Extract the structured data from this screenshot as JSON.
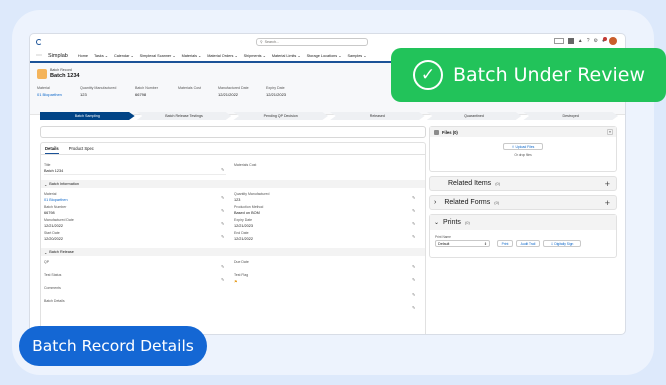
{
  "header": {
    "search_placeholder": "Search...",
    "app_name": "Simplab",
    "nav_items": [
      "Home",
      "Tasks",
      "Calendar",
      "Simplexal Scanner",
      "Materials",
      "Material Orders",
      "Shipments",
      "Material Limits",
      "Storage Locations",
      "Samples"
    ]
  },
  "record": {
    "type_label": "Batch Record",
    "name": "Batch 1234",
    "fields": [
      {
        "label": "Material",
        "value": "01 Bioparthen",
        "link": true
      },
      {
        "label": "Quantity Manufactured",
        "value": "123",
        "link": false
      },
      {
        "label": "Batch Number",
        "value": "66798",
        "link": false
      },
      {
        "label": "Materials Cost",
        "value": "",
        "link": false
      },
      {
        "label": "Manufactured Date",
        "value": "12/21/2022",
        "link": false
      },
      {
        "label": "Expiry Date",
        "value": "12/21/2023",
        "link": false
      }
    ]
  },
  "path_steps": [
    "Batch Sampling",
    "Batch Release Testings",
    "Pending QP Decision",
    "Released",
    "Quarantined",
    "Destroyed"
  ],
  "details": {
    "tabs": [
      "Details",
      "Product Spec"
    ],
    "title_label": "Title",
    "title_value": "Batch 1234",
    "materials_cost_label": "Materials Cost",
    "sections": {
      "info": "Batch Information",
      "release": "Batch Release"
    },
    "info_fields": [
      {
        "label": "Material",
        "value": "01 Bioparthen",
        "link": true
      },
      {
        "label": "Quantity Manufactured",
        "value": "123",
        "link": false
      },
      {
        "label": "Batch Number",
        "value": "66798",
        "link": false
      },
      {
        "label": "Production Method",
        "value": "Based on BOM",
        "link": false
      },
      {
        "label": "Manufactured Date",
        "value": "12/21/2022",
        "link": false
      },
      {
        "label": "Expiry Date",
        "value": "12/21/2023",
        "link": false
      },
      {
        "label": "Start Date",
        "value": "12/20/2022",
        "link": false
      },
      {
        "label": "End Date",
        "value": "12/21/2022",
        "link": false
      }
    ],
    "release_fields": [
      {
        "label": "QP",
        "value": ""
      },
      {
        "label": "Due Date",
        "value": ""
      },
      {
        "label": "Test Status",
        "value": ""
      },
      {
        "label": "Test Flag",
        "value": "flag"
      },
      {
        "label": "Comments",
        "value": ""
      },
      {
        "label": "Batch Details",
        "value": ""
      }
    ]
  },
  "right": {
    "files_title": "Files (0)",
    "upload_label": "Upload Files",
    "drop_text": "Or drop files",
    "related_items": "Related Items",
    "related_forms": "Related Forms",
    "count": "(0)",
    "prints": "Prints",
    "print_name_label": "Print Name",
    "print_name_value": "Default",
    "print_buttons": [
      "Print",
      "Audit Trail",
      "Digitally Sign"
    ]
  },
  "overlays": {
    "review_badge": "Batch Under Review",
    "details_badge": "Batch Record Details"
  },
  "colors": {
    "accent": "#1b5297",
    "review": "#22c35a",
    "details": "#1467d4",
    "path_active": "#014486"
  }
}
